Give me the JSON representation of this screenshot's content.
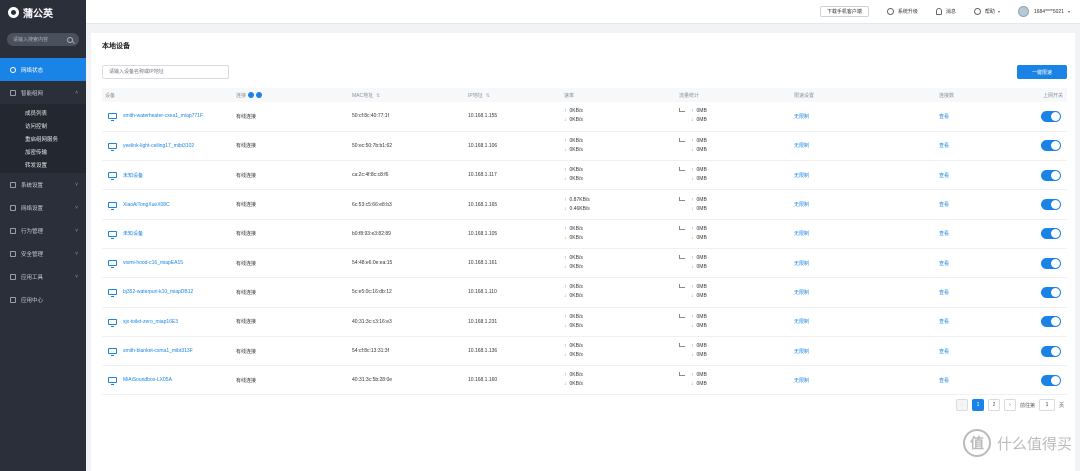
{
  "app": {
    "name": "蒲公英"
  },
  "sidebar": {
    "search_placeholder": "请输入搜索内容",
    "items": [
      {
        "label": "网络状态",
        "active": true
      },
      {
        "label": "智能组网"
      },
      {
        "label": "系统设置"
      },
      {
        "label": "网络设置"
      },
      {
        "label": "行为管理"
      },
      {
        "label": "安全管理"
      },
      {
        "label": "应用工具"
      },
      {
        "label": "应用中心"
      }
    ],
    "sub_items": [
      "成员列表",
      "访问控制",
      "重启组网服务",
      "加密传输",
      "转发设置"
    ]
  },
  "topbar": {
    "download_client": "下载手机客户端",
    "system_upgrade": "系统升级",
    "messages": "消息",
    "help": "帮助",
    "user": "1684****5021"
  },
  "page": {
    "title": "本地设备",
    "search_placeholder": "请输入设备名称或IP地址",
    "primary_button": "一键限速"
  },
  "table": {
    "headers": {
      "device": "设备",
      "connection": "连接",
      "mac": "MAC地址",
      "ip": "IP地址",
      "rate": "速率",
      "traffic": "流量统计",
      "limit": "限速设置",
      "conn_count": "连接数",
      "online": "上网开关"
    },
    "rows": [
      {
        "name": "smith-waterheater-cxea1_miap771F",
        "conn": "有线连接",
        "mac": "50:cf:8c:40:77:1f",
        "ip": "10.168.1.155",
        "up": "0KB/s",
        "down": "0KB/s",
        "flow_up": "0MB",
        "flow_down": "0MB",
        "limit": "无限制",
        "view": "查看"
      },
      {
        "name": "yeelink-light-ceiling17_mibt3102",
        "conn": "有线连接",
        "mac": "50:ec:50:7b:b1:62",
        "ip": "10.168.1.106",
        "up": "0KB/s",
        "down": "0KB/s",
        "flow_up": "0MB",
        "flow_down": "0MB",
        "limit": "无限制",
        "view": "查看"
      },
      {
        "name": "未知设备",
        "conn": "有线连接",
        "mac": "ca:2c:4f:8c:c8:f6",
        "ip": "10.168.1.117",
        "up": "0KB/s",
        "down": "0KB/s",
        "flow_up": "0MB",
        "flow_down": "0MB",
        "limit": "无限制",
        "view": "查看"
      },
      {
        "name": "XiaoAiTongXueX08C",
        "conn": "有线连接",
        "mac": "6c:53:c5:66:e8:b3",
        "ip": "10.168.1.165",
        "up": "0.87KB/s",
        "down": "0.46KB/s",
        "flow_up": "0MB",
        "flow_down": "0MB",
        "limit": "无限制",
        "view": "查看"
      },
      {
        "name": "未知设备",
        "conn": "有线连接",
        "mac": "b0:f8:93:e3:82:89",
        "ip": "10.168.1.105",
        "up": "0KB/s",
        "down": "0KB/s",
        "flow_up": "0MB",
        "flow_down": "0MB",
        "limit": "无限制",
        "view": "查看"
      },
      {
        "name": "viomi-hood-c16_miapEA15",
        "conn": "有线连接",
        "mac": "54:48:e6:0e:ea:15",
        "ip": "10.168.1.161",
        "up": "0KB/s",
        "down": "0KB/s",
        "flow_up": "0MB",
        "flow_down": "0MB",
        "limit": "无限制",
        "view": "查看"
      },
      {
        "name": "bj352-waterpuri-k10_miapDB12",
        "conn": "有线连接",
        "mac": "5c:e5:0c:16:db:12",
        "ip": "10.168.1.110",
        "up": "0KB/s",
        "down": "0KB/s",
        "flow_up": "0MB",
        "flow_down": "0MB",
        "limit": "无限制",
        "view": "查看"
      },
      {
        "name": "xjx-toilet-zero_miap16E3",
        "conn": "有线连接",
        "mac": "40:31:3c:c3:16:e3",
        "ip": "10.168.1.231",
        "up": "0KB/s",
        "down": "0KB/s",
        "flow_up": "0MB",
        "flow_down": "0MB",
        "limit": "无限制",
        "view": "查看"
      },
      {
        "name": "smith-blanket-cxma1_mibt313F",
        "conn": "有线连接",
        "mac": "54:cf:8c:13:31:3f",
        "ip": "10.168.1.136",
        "up": "0KB/s",
        "down": "0KB/s",
        "flow_up": "0MB",
        "flow_down": "0MB",
        "limit": "无限制",
        "view": "查看"
      },
      {
        "name": "MiAiSoundbox-LX05A",
        "conn": "有线连接",
        "mac": "40:31:3c:5b:28:0e",
        "ip": "10.168.1.160",
        "up": "0KB/s",
        "down": "0KB/s",
        "flow_up": "0MB",
        "flow_down": "0MB",
        "limit": "无限制",
        "view": "查看"
      }
    ]
  },
  "pagination": {
    "prev": "‹",
    "pages": [
      "1",
      "2"
    ],
    "next": "›",
    "goto_label": "前往第",
    "goto_value": "1",
    "page_suffix": "页"
  },
  "watermark": {
    "logo": "值",
    "text": "什么值得买"
  },
  "colors": {
    "accent": "#1a84e6",
    "sidebar": "#2a2f3a",
    "download": "#52c41a"
  }
}
